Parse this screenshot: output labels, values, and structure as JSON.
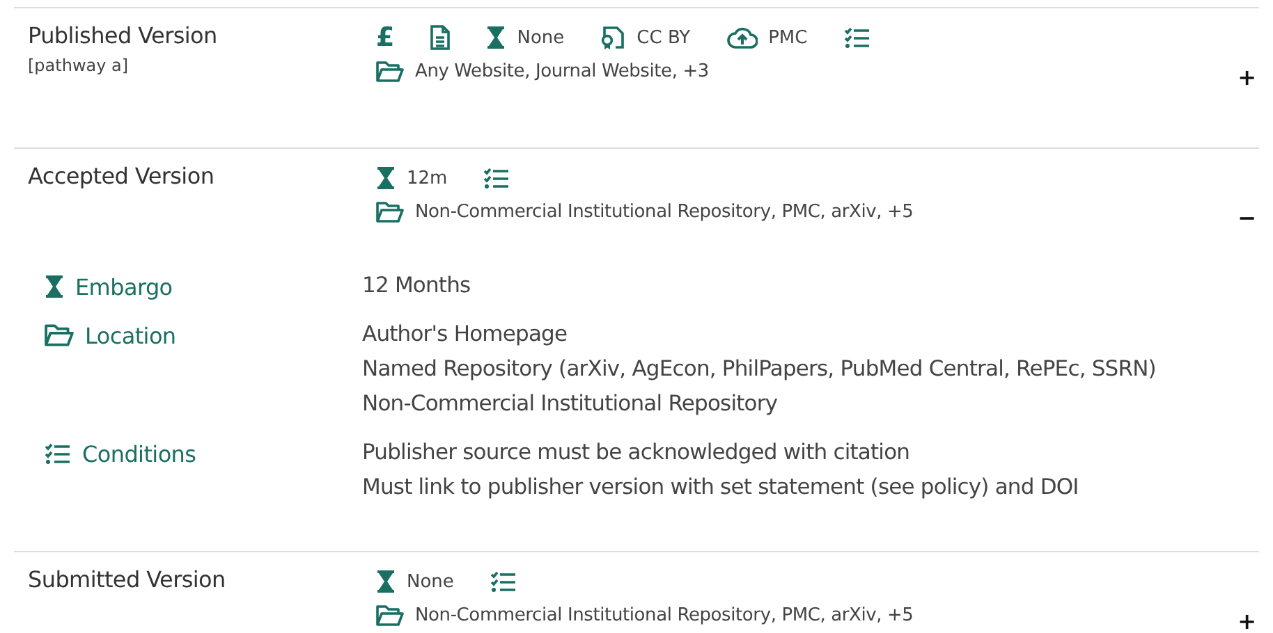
{
  "sections": [
    {
      "title": "Published Version",
      "subtitle": "[pathway a]",
      "toggle": "+",
      "badges": [
        {
          "kind": "fee",
          "symbol": "£"
        },
        {
          "kind": "document"
        },
        {
          "kind": "embargo",
          "text": "None"
        },
        {
          "kind": "license",
          "text": "CC BY"
        },
        {
          "kind": "deposit",
          "text": "PMC"
        },
        {
          "kind": "conditions"
        }
      ],
      "location": "Any Website, Journal Website, +3"
    },
    {
      "title": "Accepted Version",
      "toggle": "−",
      "badges": [
        {
          "kind": "embargo",
          "text": "12m"
        },
        {
          "kind": "conditions"
        }
      ],
      "location": "Non-Commercial Institutional Repository, PMC, arXiv, +5",
      "details": [
        {
          "kind": "embargo",
          "label": "Embargo",
          "values": [
            "12 Months"
          ]
        },
        {
          "kind": "location",
          "label": "Location",
          "values": [
            "Author's Homepage",
            "Named Repository (arXiv, AgEcon, PhilPapers, PubMed Central, RePEc, SSRN)",
            "Non-Commercial Institutional Repository"
          ]
        },
        {
          "kind": "conditions",
          "label": "Conditions",
          "values": [
            "Publisher source must be acknowledged with citation",
            "Must link to publisher version with set statement (see policy) and DOI"
          ]
        }
      ]
    },
    {
      "title": "Submitted Version",
      "toggle": "+",
      "badges": [
        {
          "kind": "embargo",
          "text": "None"
        },
        {
          "kind": "conditions"
        }
      ],
      "location": "Non-Commercial Institutional Repository, PMC, arXiv, +5"
    }
  ]
}
